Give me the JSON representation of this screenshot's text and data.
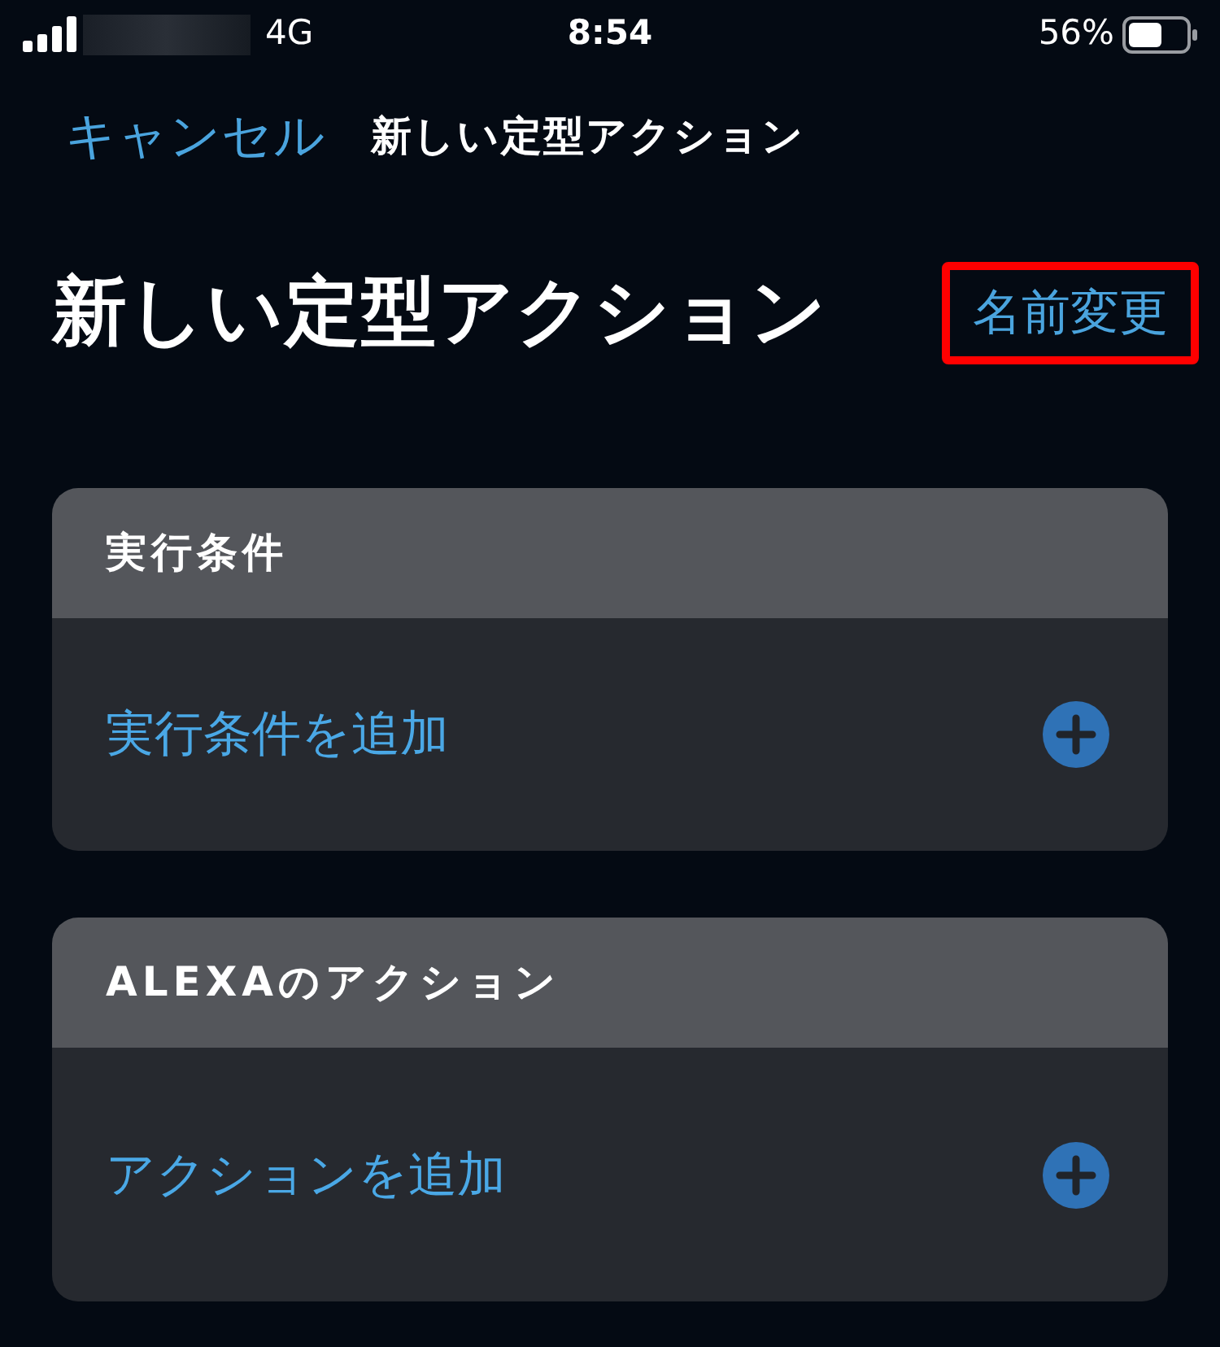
{
  "status_bar": {
    "network": "4G",
    "time": "8:54",
    "battery": "56%"
  },
  "nav": {
    "cancel": "キャンセル",
    "title": "新しい定型アクション"
  },
  "header": {
    "title": "新しい定型アクション",
    "rename": {
      "label": "名前変更",
      "highlighted": true
    }
  },
  "sections": [
    {
      "title": "実行条件",
      "add_label": "実行条件を追加"
    },
    {
      "title": "ALEXAのアクション",
      "add_label": "アクションを追加"
    }
  ]
}
